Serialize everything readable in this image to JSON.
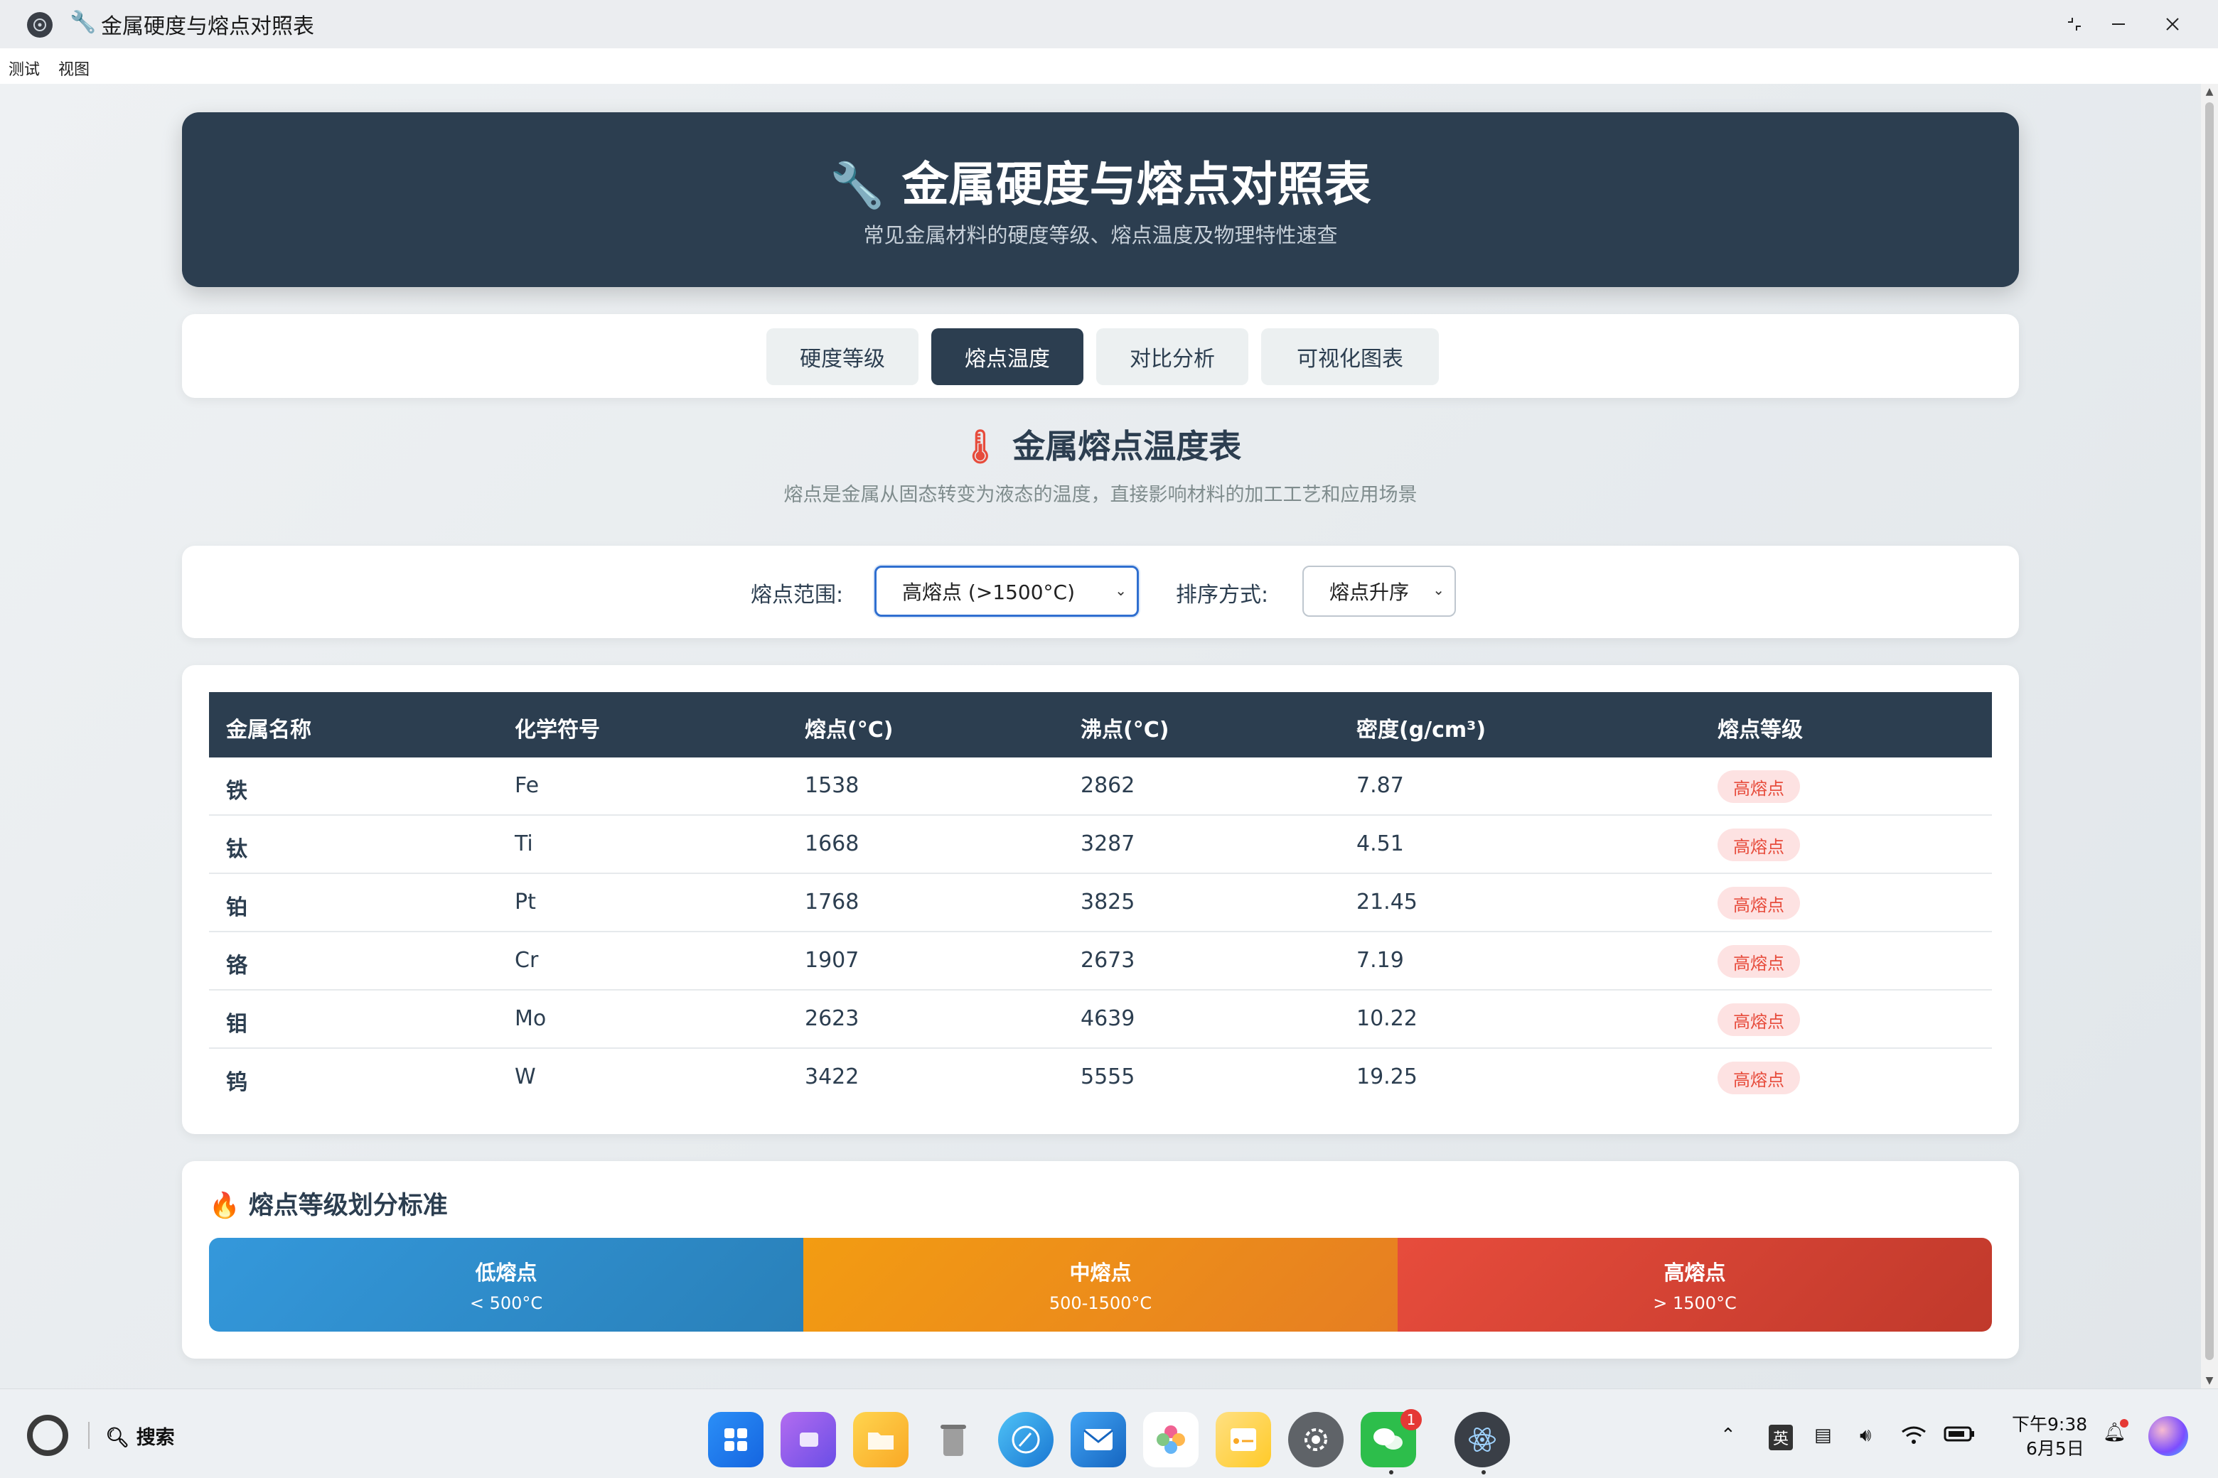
{
  "window": {
    "title": "金属硬度与熔点对照表",
    "menu": [
      "测试",
      "视图"
    ]
  },
  "header": {
    "title": "金属硬度与熔点对照表",
    "subtitle": "常见金属材料的硬度等级、熔点温度及物理特性速查"
  },
  "tabs": [
    {
      "label": "硬度等级",
      "active": false
    },
    {
      "label": "熔点温度",
      "active": true
    },
    {
      "label": "对比分析",
      "active": false
    },
    {
      "label": "可视化图表",
      "active": false
    }
  ],
  "section": {
    "title": "金属熔点温度表",
    "subtitle": "熔点是金属从固态转变为液态的温度，直接影响材料的加工工艺和应用场景"
  },
  "filters": {
    "range_label": "熔点范围:",
    "range_value": "高熔点 (>1500°C)",
    "sort_label": "排序方式:",
    "sort_value": "熔点升序"
  },
  "table": {
    "columns": [
      "金属名称",
      "化学符号",
      "熔点(°C)",
      "沸点(°C)",
      "密度(g/cm³)",
      "熔点等级"
    ],
    "rows": [
      {
        "name": "铁",
        "symbol": "Fe",
        "melting": "1538",
        "boiling": "2862",
        "density": "7.87",
        "level": "高熔点"
      },
      {
        "name": "钛",
        "symbol": "Ti",
        "melting": "1668",
        "boiling": "3287",
        "density": "4.51",
        "level": "高熔点"
      },
      {
        "name": "铂",
        "symbol": "Pt",
        "melting": "1768",
        "boiling": "3825",
        "density": "21.45",
        "level": "高熔点"
      },
      {
        "name": "铬",
        "symbol": "Cr",
        "melting": "1907",
        "boiling": "2673",
        "density": "7.19",
        "level": "高熔点"
      },
      {
        "name": "钼",
        "symbol": "Mo",
        "melting": "2623",
        "boiling": "4639",
        "density": "10.22",
        "level": "高熔点"
      },
      {
        "name": "钨",
        "symbol": "W",
        "melting": "3422",
        "boiling": "5555",
        "density": "19.25",
        "level": "高熔点"
      }
    ]
  },
  "legend": {
    "title": "熔点等级划分标准",
    "segments": [
      {
        "title": "低熔点",
        "range": "< 500°C",
        "color_from": "#3498db",
        "color_to": "#2980b9"
      },
      {
        "title": "中熔点",
        "range": "500-1500°C",
        "color_from": "#f39c12",
        "color_to": "#e67e22"
      },
      {
        "title": "高熔点",
        "range": "> 1500°C",
        "color_from": "#e74c3c",
        "color_to": "#c0392b"
      }
    ]
  },
  "taskbar": {
    "search_label": "搜索",
    "ime": "英",
    "time": "下午9:38",
    "date": "6月5日",
    "wechat_badge": "1"
  },
  "colors": {
    "primary": "#2c3e50",
    "badge_bg": "#fde2e2",
    "badge_text": "#e74c3c"
  }
}
